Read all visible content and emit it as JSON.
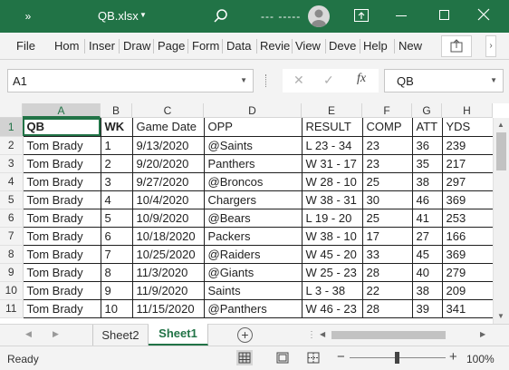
{
  "window": {
    "filename": "QB.xlsx",
    "account_placeholder": "--- -----"
  },
  "ribbon": {
    "tabs": [
      "File",
      "Hom",
      "Inser",
      "Draw",
      "Page",
      "Form",
      "Data",
      "Revie",
      "View",
      "Deve",
      "Help",
      "New"
    ]
  },
  "formula_bar": {
    "name_box": "A1",
    "formula": "QB"
  },
  "sheet": {
    "columns": [
      "A",
      "B",
      "C",
      "D",
      "E",
      "F",
      "G",
      "H"
    ],
    "row_numbers": [
      "1",
      "2",
      "3",
      "4",
      "5",
      "6",
      "7",
      "8",
      "9",
      "10",
      "11"
    ],
    "headers": [
      "QB",
      "WK",
      "Game Date",
      "OPP",
      "RESULT",
      "COMP",
      "ATT",
      "YDS"
    ],
    "rows": [
      [
        "Tom Brady",
        "1",
        "9/13/2020",
        "@Saints",
        "L 23 - 34",
        "23",
        "36",
        "239"
      ],
      [
        "Tom Brady",
        "2",
        "9/20/2020",
        "Panthers",
        "W 31 - 17",
        "23",
        "35",
        "217"
      ],
      [
        "Tom Brady",
        "3",
        "9/27/2020",
        "@Broncos",
        "W 28 - 10",
        "25",
        "38",
        "297"
      ],
      [
        "Tom Brady",
        "4",
        "10/4/2020",
        "Chargers",
        "W 38 - 31",
        "30",
        "46",
        "369"
      ],
      [
        "Tom Brady",
        "5",
        "10/9/2020",
        "@Bears",
        "L 19 - 20",
        "25",
        "41",
        "253"
      ],
      [
        "Tom Brady",
        "6",
        "10/18/2020",
        "Packers",
        "W 38 - 10",
        "17",
        "27",
        "166"
      ],
      [
        "Tom Brady",
        "7",
        "10/25/2020",
        "@Raiders",
        "W 45 - 20",
        "33",
        "45",
        "369"
      ],
      [
        "Tom Brady",
        "8",
        "11/3/2020",
        "@Giants",
        "W 25 - 23",
        "28",
        "40",
        "279"
      ],
      [
        "Tom Brady",
        "9",
        "11/9/2020",
        "Saints",
        "L 3 - 38",
        "22",
        "38",
        "209"
      ],
      [
        "Tom Brady",
        "10",
        "11/15/2020",
        "@Panthers",
        "W 46 - 23",
        "28",
        "39",
        "341"
      ]
    ]
  },
  "sheet_tabs": {
    "tabs": [
      "Sheet2",
      "Sheet1"
    ],
    "active": "Sheet1"
  },
  "status": {
    "ready_text": "Ready",
    "zoom": "100%"
  },
  "colors": {
    "excel_green": "#217346",
    "chrome_gray": "#f3f3f3"
  },
  "icons": [
    "ribbon-toggle-icon",
    "dropdown-caret-icon",
    "search-icon",
    "avatar-icon",
    "restore-ribbon-icon",
    "minimize-icon",
    "maximize-icon",
    "close-icon",
    "share-icon",
    "cancel-icon",
    "enter-icon",
    "function-icon",
    "add-sheet-icon",
    "normal-view-icon",
    "page-layout-icon",
    "page-break-icon"
  ]
}
